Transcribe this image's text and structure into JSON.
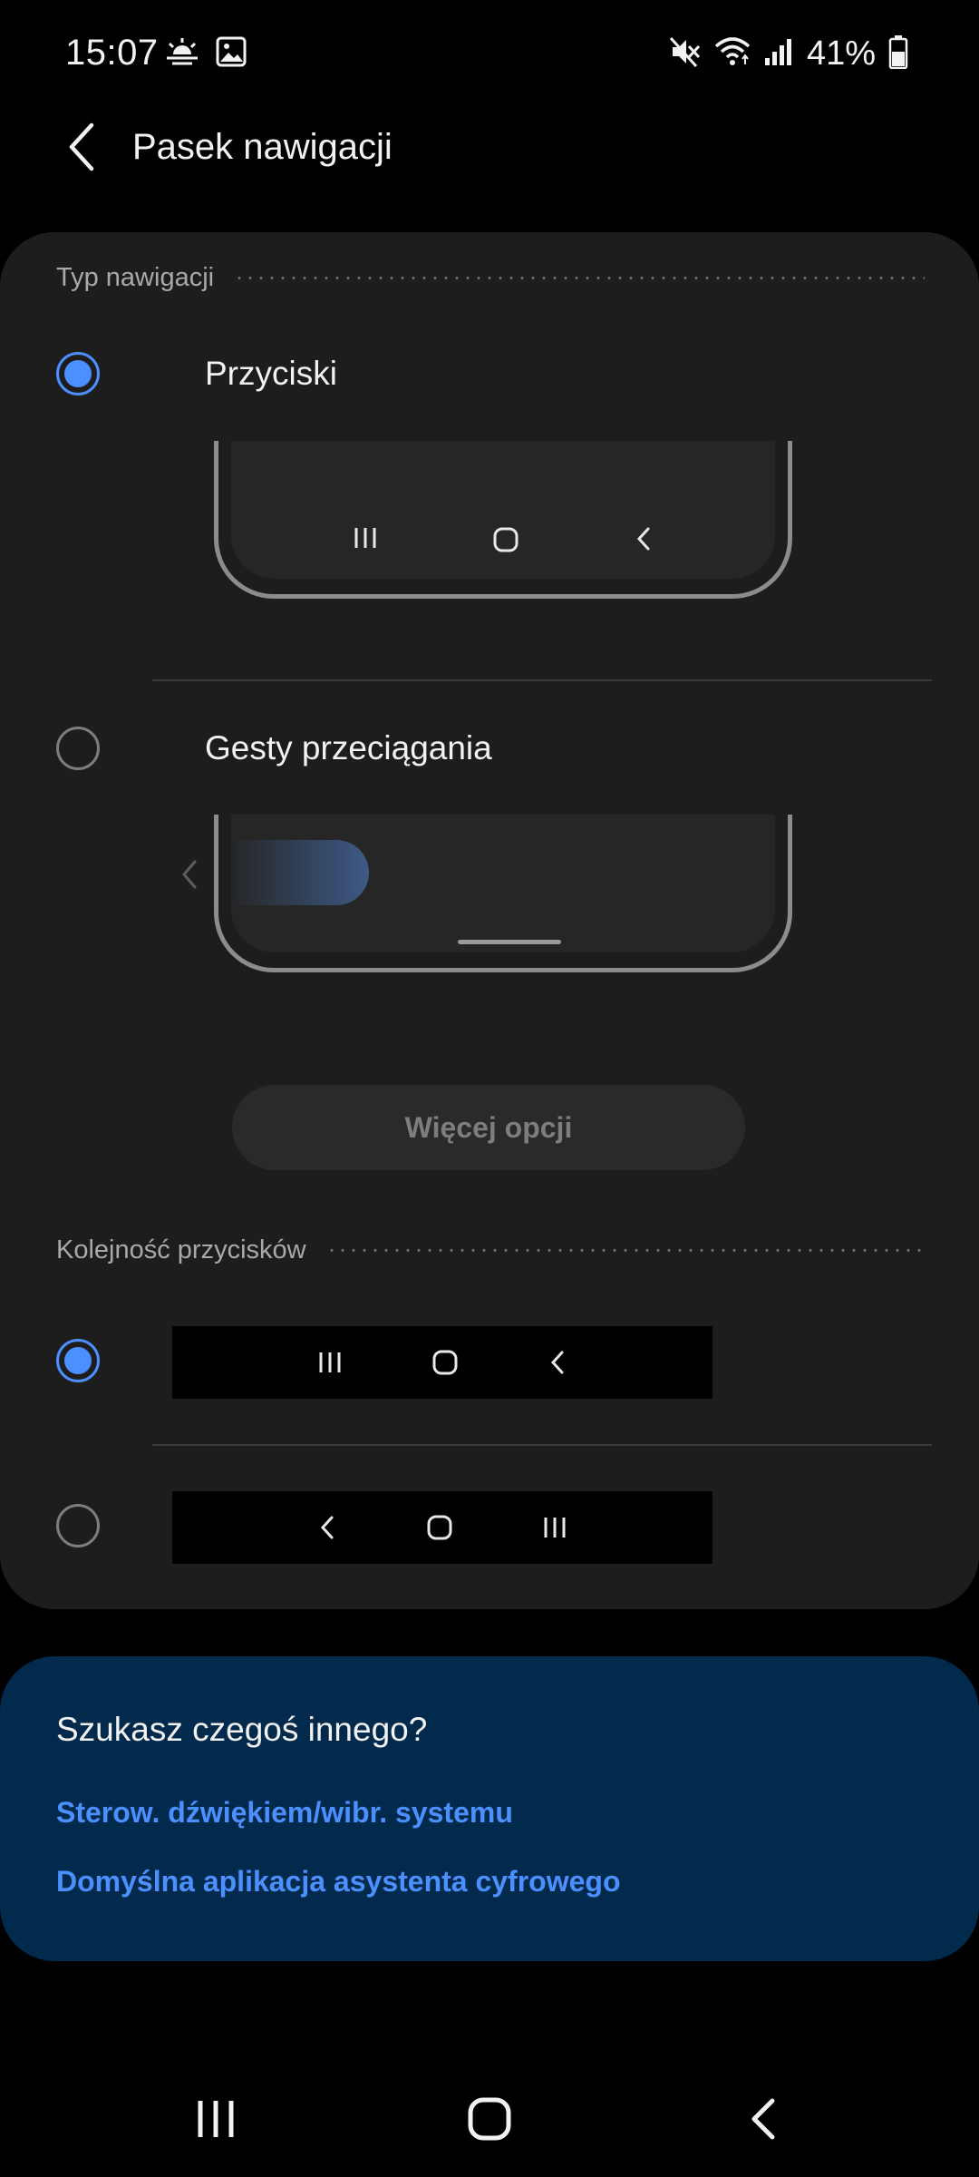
{
  "status": {
    "time": "15:07",
    "battery": "41%",
    "icons": [
      "sunrise-icon",
      "image-icon",
      "mute-icon",
      "wifi-icon",
      "signal-icon",
      "battery-icon"
    ]
  },
  "header": {
    "title": "Pasek nawigacji",
    "back_icon": "chevron-left-icon"
  },
  "navigation_type": {
    "section_title": "Typ nawigacji",
    "options": [
      {
        "label": "Przyciski",
        "selected": true
      },
      {
        "label": "Gesty przeciągania",
        "selected": false
      }
    ],
    "more_options_label": "Więcej opcji"
  },
  "button_order": {
    "section_title": "Kolejność przycisków",
    "options": [
      {
        "selected": true,
        "order": [
          "recents",
          "home",
          "back"
        ]
      },
      {
        "selected": false,
        "order": [
          "back",
          "home",
          "recents"
        ]
      }
    ]
  },
  "suggestions": {
    "title": "Szukasz czegoś innego?",
    "links": [
      "Sterow. dźwiękiem/wibr. systemu",
      "Domyślna aplikacja asystenta cyfrowego"
    ]
  },
  "colors": {
    "accent": "#4c90ff",
    "card": "#1d1d1d",
    "suggestion_card": "#022a4d"
  }
}
